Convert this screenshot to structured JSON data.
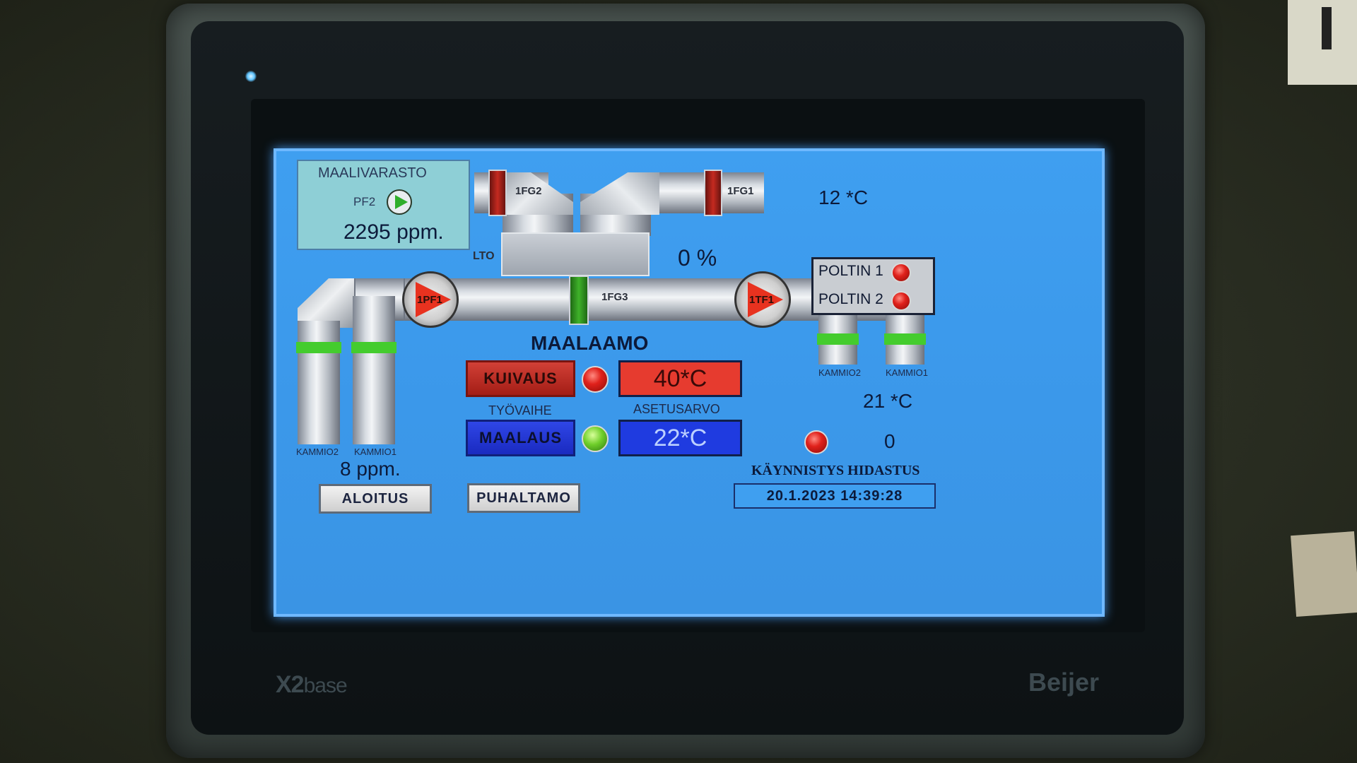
{
  "device": {
    "model": "X2",
    "model_suffix": "base",
    "maker": "Beijer"
  },
  "screen": {
    "paint_storage": {
      "title": "MAALIVARASTO",
      "pump_label": "PF2",
      "ppm": "2295 ppm."
    },
    "dampers": {
      "fg2": "1FG2",
      "fg1": "1FG1",
      "fg3": "1FG3"
    },
    "lto_label": "LTO",
    "lto_percent": "0 %",
    "outdoor_temp": "12 *C",
    "pumps": {
      "pf1": "1PF1",
      "tf1": "1TF1"
    },
    "burners": [
      {
        "label": "POLTIN 1",
        "status": "red"
      },
      {
        "label": "POLTIN 2",
        "status": "red"
      }
    ],
    "chambers_left": [
      "KAMMIO2",
      "KAMMIO1"
    ],
    "chambers_right": [
      "KAMMIO2",
      "KAMMIO1"
    ],
    "left_ppm": "8 ppm.",
    "section_title": "MAALAAMO",
    "phases": {
      "header": "TYÖVAIHE",
      "drying_label": "KUIVAUS",
      "drying_status": "red",
      "painting_label": "MAALAUS",
      "painting_status": "green"
    },
    "setpoints": {
      "header": "ASETUSARVO",
      "drying_setpoint": "40*C",
      "painting_setpoint": "22*C"
    },
    "room_temp": "21 *C",
    "startup_delay": {
      "value": "0",
      "label": "KÄYNNISTYS HIDASTUS",
      "status": "red"
    },
    "buttons": {
      "start": "ALOITUS",
      "blower_room": "PUHALTAMO"
    },
    "datetime": "20.1.2023 14:39:28"
  }
}
